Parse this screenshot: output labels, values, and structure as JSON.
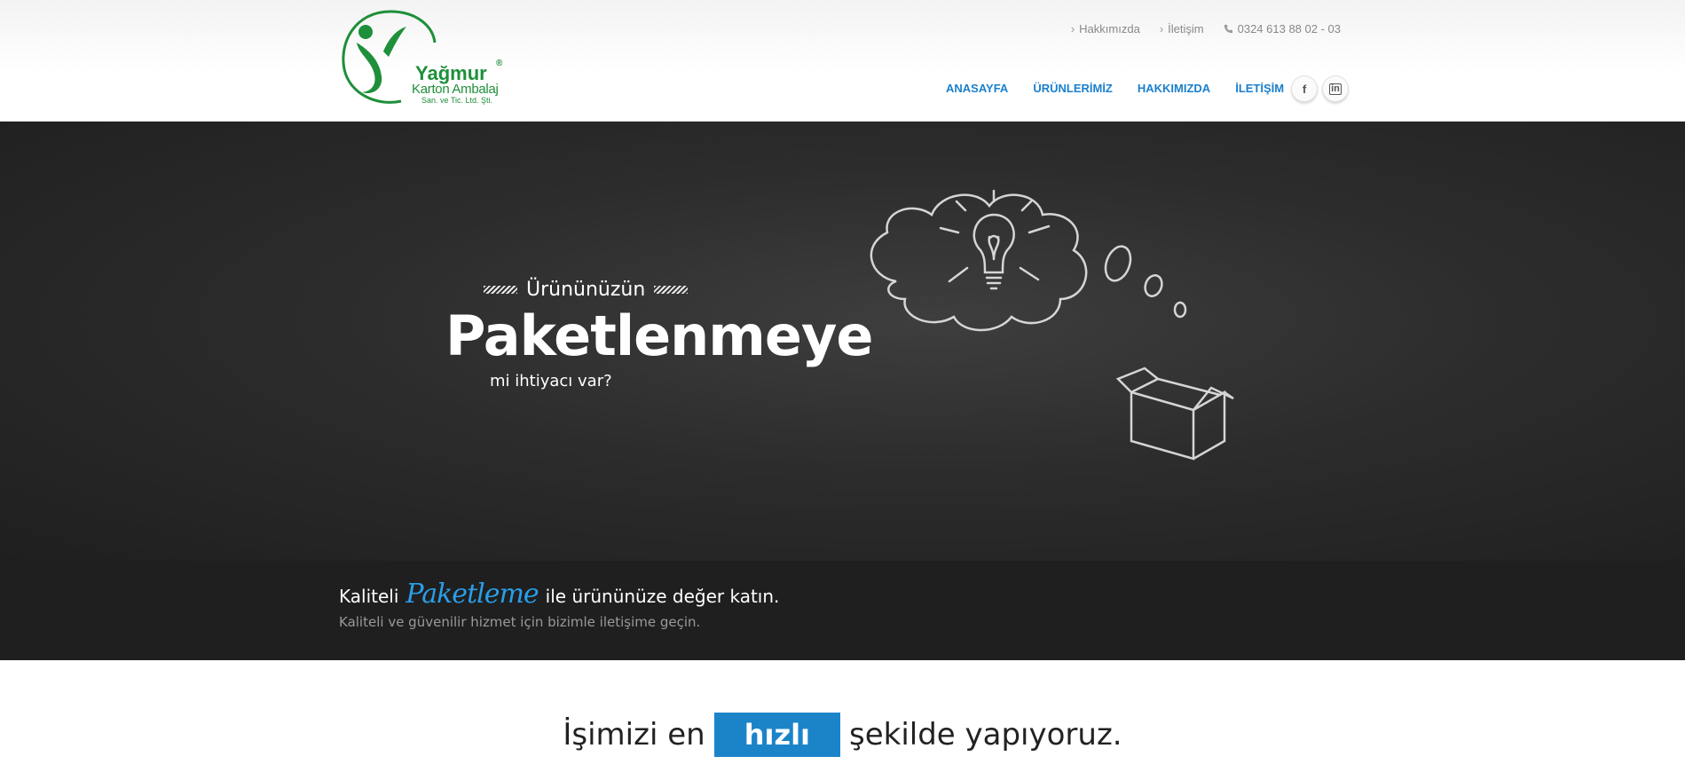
{
  "logo": {
    "name": "Yağmur",
    "registered": "®",
    "subtitle": "Karton Ambalaj",
    "subtitle2": "San. ve Tic. Ltd. Şti."
  },
  "toplinks": {
    "about": "Hakkımızda",
    "contact": "İletişim",
    "phone": "0324 613 88 02 - 03"
  },
  "nav": {
    "home": "ANASAYFA",
    "products": "ÜRÜNLERİMİZ",
    "about": "HAKKIMIZDA",
    "contact": "İLETİŞİM"
  },
  "social": {
    "facebook": "f",
    "linkedin": "in"
  },
  "hero": {
    "pre": "Ürününüzün",
    "title": "Paketlenmeye",
    "sub": "mi ihtiyacı var?"
  },
  "band": {
    "prefix": "Kaliteli",
    "script": "Paketleme",
    "suffix": "ile ürününüze değer katın.",
    "line2": "Kaliteli ve güvenilir hizmet için bizimle iletişime geçin."
  },
  "tagline": {
    "before": "İşimizi en",
    "highlight": "hızlı",
    "after": "şekilde yapıyoruz."
  },
  "colors": {
    "brand_green": "#1e8f3a",
    "nav_blue": "#1b7fcc",
    "highlight_blue": "#1b84c9",
    "script_blue": "#2a9ee8"
  }
}
